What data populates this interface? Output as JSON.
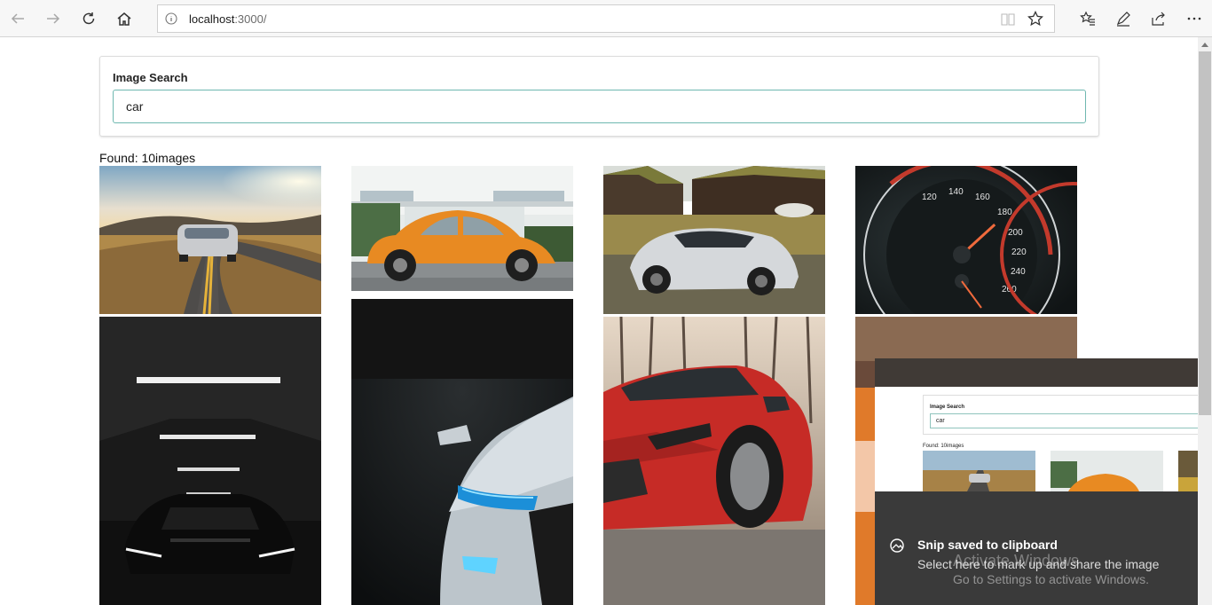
{
  "browser": {
    "url_host": "localhost",
    "url_rest": ":3000/"
  },
  "page": {
    "search_label": "Image Search",
    "search_value": "car",
    "found_text": "Found: 10images"
  },
  "images": [
    {
      "name": "road-car-sunset"
    },
    {
      "name": "orange-beetle"
    },
    {
      "name": "white-sports-car"
    },
    {
      "name": "speedometer"
    },
    {
      "name": "dark-garage-car"
    },
    {
      "name": "white-audi-headlight"
    },
    {
      "name": "red-hatchback"
    },
    {
      "name": "car-partial"
    }
  ],
  "toast": {
    "title": "Snip saved to clipboard",
    "body": "Select here to mark up and share the image",
    "mini_label": "Image Search",
    "mini_value": "car",
    "mini_found": "Found: 10images"
  },
  "watermark": {
    "line1": "Activate Windows",
    "line2": "Go to Settings to activate Windows."
  }
}
